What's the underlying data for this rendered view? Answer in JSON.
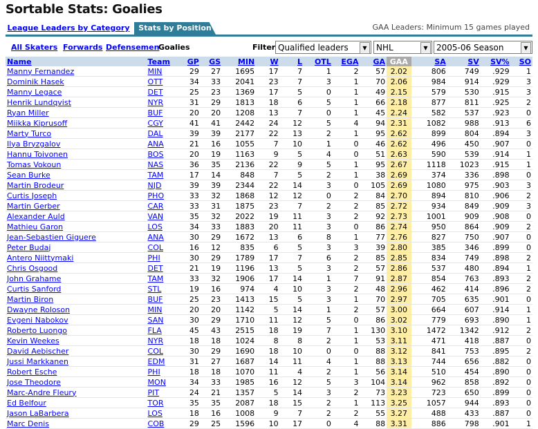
{
  "page_title": "Sortable Stats: Goalies",
  "tabs": [
    {
      "label": "League Leaders by Category",
      "active": false
    },
    {
      "label": "Stats by Position",
      "active": true
    }
  ],
  "tab_note": "GAA Leaders: Minimum 15 games played",
  "subnav": {
    "links": [
      "All Skaters",
      "Forwards",
      "Defensemen"
    ],
    "current": "Goalies"
  },
  "filter": {
    "label": "Filter:",
    "qualifier": "Qualified leaders",
    "league": "NHL",
    "season": "2005-06 Season"
  },
  "columns": [
    "Name",
    "Team",
    "GP",
    "GS",
    "MIN",
    "W",
    "L",
    "OTL",
    "EGA",
    "GA",
    "GAA",
    "SA",
    "SV",
    "SV%",
    "SO"
  ],
  "sorted_column": "GAA",
  "rows": [
    [
      "Manny Fernandez",
      "MIN",
      "29",
      "27",
      "1695",
      "17",
      "7",
      "1",
      "2",
      "57",
      "2.02",
      "806",
      "749",
      ".929",
      "1"
    ],
    [
      "Dominik Hasek",
      "OTT",
      "34",
      "33",
      "2041",
      "23",
      "7",
      "3",
      "1",
      "70",
      "2.06",
      "984",
      "914",
      ".929",
      "3"
    ],
    [
      "Manny Legace",
      "DET",
      "25",
      "23",
      "1369",
      "17",
      "5",
      "0",
      "1",
      "49",
      "2.15",
      "579",
      "530",
      ".915",
      "3"
    ],
    [
      "Henrik Lundqvist",
      "NYR",
      "31",
      "29",
      "1813",
      "18",
      "6",
      "5",
      "1",
      "66",
      "2.18",
      "877",
      "811",
      ".925",
      "2"
    ],
    [
      "Ryan Miller",
      "BUF",
      "20",
      "20",
      "1208",
      "13",
      "7",
      "0",
      "1",
      "45",
      "2.24",
      "582",
      "537",
      ".923",
      "0"
    ],
    [
      "Miikka Kiprusoff",
      "CGY",
      "41",
      "41",
      "2442",
      "24",
      "12",
      "5",
      "4",
      "94",
      "2.31",
      "1082",
      "988",
      ".913",
      "6"
    ],
    [
      "Marty Turco",
      "DAL",
      "39",
      "39",
      "2177",
      "22",
      "13",
      "2",
      "1",
      "95",
      "2.62",
      "899",
      "804",
      ".894",
      "3"
    ],
    [
      "Ilya Bryzgalov",
      "ANA",
      "21",
      "16",
      "1055",
      "7",
      "10",
      "1",
      "0",
      "46",
      "2.62",
      "496",
      "450",
      ".907",
      "0"
    ],
    [
      "Hannu Toivonen",
      "BOS",
      "20",
      "19",
      "1163",
      "9",
      "5",
      "4",
      "0",
      "51",
      "2.63",
      "590",
      "539",
      ".914",
      "1"
    ],
    [
      "Tomas Vokoun",
      "NAS",
      "36",
      "35",
      "2136",
      "22",
      "9",
      "5",
      "1",
      "95",
      "2.67",
      "1118",
      "1023",
      ".915",
      "1"
    ],
    [
      "Sean Burke",
      "TAM",
      "17",
      "14",
      "848",
      "7",
      "5",
      "2",
      "1",
      "38",
      "2.69",
      "374",
      "336",
      ".898",
      "0"
    ],
    [
      "Martin Brodeur",
      "NJD",
      "39",
      "39",
      "2344",
      "22",
      "14",
      "3",
      "0",
      "105",
      "2.69",
      "1080",
      "975",
      ".903",
      "3"
    ],
    [
      "Curtis Joseph",
      "PHO",
      "33",
      "32",
      "1868",
      "12",
      "12",
      "0",
      "2",
      "84",
      "2.70",
      "894",
      "810",
      ".906",
      "2"
    ],
    [
      "Martin Gerber",
      "CAR",
      "33",
      "31",
      "1875",
      "23",
      "7",
      "2",
      "2",
      "85",
      "2.72",
      "934",
      "849",
      ".909",
      "3"
    ],
    [
      "Alexander Auld",
      "VAN",
      "35",
      "32",
      "2022",
      "19",
      "11",
      "3",
      "2",
      "92",
      "2.73",
      "1001",
      "909",
      ".908",
      "0"
    ],
    [
      "Mathieu Garon",
      "LOS",
      "34",
      "33",
      "1883",
      "20",
      "11",
      "3",
      "0",
      "86",
      "2.74",
      "950",
      "864",
      ".909",
      "2"
    ],
    [
      "Jean-Sebastien Giguere",
      "ANA",
      "30",
      "29",
      "1672",
      "13",
      "6",
      "8",
      "1",
      "77",
      "2.76",
      "827",
      "750",
      ".907",
      "0"
    ],
    [
      "Peter Budaj",
      "COL",
      "16",
      "12",
      "835",
      "6",
      "5",
      "3",
      "3",
      "39",
      "2.80",
      "385",
      "346",
      ".899",
      "0"
    ],
    [
      "Antero Niittymaki",
      "PHI",
      "30",
      "29",
      "1789",
      "17",
      "7",
      "6",
      "2",
      "85",
      "2.85",
      "834",
      "749",
      ".898",
      "2"
    ],
    [
      "Chris Osgood",
      "DET",
      "21",
      "19",
      "1196",
      "13",
      "5",
      "3",
      "2",
      "57",
      "2.86",
      "537",
      "480",
      ".894",
      "1"
    ],
    [
      "John Grahame",
      "TAM",
      "33",
      "32",
      "1906",
      "17",
      "14",
      "1",
      "7",
      "91",
      "2.87",
      "854",
      "763",
      ".893",
      "2"
    ],
    [
      "Curtis Sanford",
      "STL",
      "19",
      "16",
      "974",
      "4",
      "10",
      "3",
      "2",
      "48",
      "2.96",
      "462",
      "414",
      ".896",
      "2"
    ],
    [
      "Martin Biron",
      "BUF",
      "25",
      "23",
      "1413",
      "15",
      "5",
      "3",
      "1",
      "70",
      "2.97",
      "705",
      "635",
      ".901",
      "0"
    ],
    [
      "Dwayne Roloson",
      "MIN",
      "20",
      "20",
      "1142",
      "5",
      "14",
      "1",
      "2",
      "57",
      "3.00",
      "664",
      "607",
      ".914",
      "1"
    ],
    [
      "Evgeni Nabokov",
      "SAN",
      "30",
      "29",
      "1710",
      "11",
      "12",
      "5",
      "0",
      "86",
      "3.02",
      "779",
      "693",
      ".890",
      "1"
    ],
    [
      "Roberto Luongo",
      "FLA",
      "45",
      "43",
      "2515",
      "18",
      "19",
      "7",
      "1",
      "130",
      "3.10",
      "1472",
      "1342",
      ".912",
      "2"
    ],
    [
      "Kevin Weekes",
      "NYR",
      "18",
      "18",
      "1024",
      "8",
      "8",
      "2",
      "1",
      "53",
      "3.11",
      "471",
      "418",
      ".887",
      "0"
    ],
    [
      "David Aebischer",
      "COL",
      "30",
      "29",
      "1690",
      "18",
      "10",
      "0",
      "0",
      "88",
      "3.12",
      "841",
      "753",
      ".895",
      "2"
    ],
    [
      "Jussi Markkanen",
      "EDM",
      "31",
      "27",
      "1687",
      "14",
      "11",
      "4",
      "1",
      "88",
      "3.13",
      "744",
      "656",
      ".882",
      "0"
    ],
    [
      "Robert Esche",
      "PHI",
      "18",
      "18",
      "1070",
      "11",
      "4",
      "2",
      "1",
      "56",
      "3.14",
      "510",
      "454",
      ".890",
      "0"
    ],
    [
      "Jose Theodore",
      "MON",
      "34",
      "33",
      "1985",
      "16",
      "12",
      "5",
      "3",
      "104",
      "3.14",
      "962",
      "858",
      ".892",
      "0"
    ],
    [
      "Marc-Andre Fleury",
      "PIT",
      "24",
      "21",
      "1357",
      "5",
      "14",
      "3",
      "2",
      "73",
      "3.23",
      "723",
      "650",
      ".899",
      "0"
    ],
    [
      "Ed Belfour",
      "TOR",
      "35",
      "35",
      "2087",
      "18",
      "15",
      "2",
      "1",
      "113",
      "3.25",
      "1057",
      "944",
      ".893",
      "0"
    ],
    [
      "Jason LaBarbera",
      "LOS",
      "18",
      "16",
      "1008",
      "9",
      "7",
      "2",
      "2",
      "55",
      "3.27",
      "488",
      "433",
      ".887",
      "0"
    ],
    [
      "Marc Denis",
      "COB",
      "29",
      "25",
      "1596",
      "10",
      "17",
      "0",
      "4",
      "88",
      "3.31",
      "886",
      "798",
      ".901",
      "1"
    ]
  ]
}
